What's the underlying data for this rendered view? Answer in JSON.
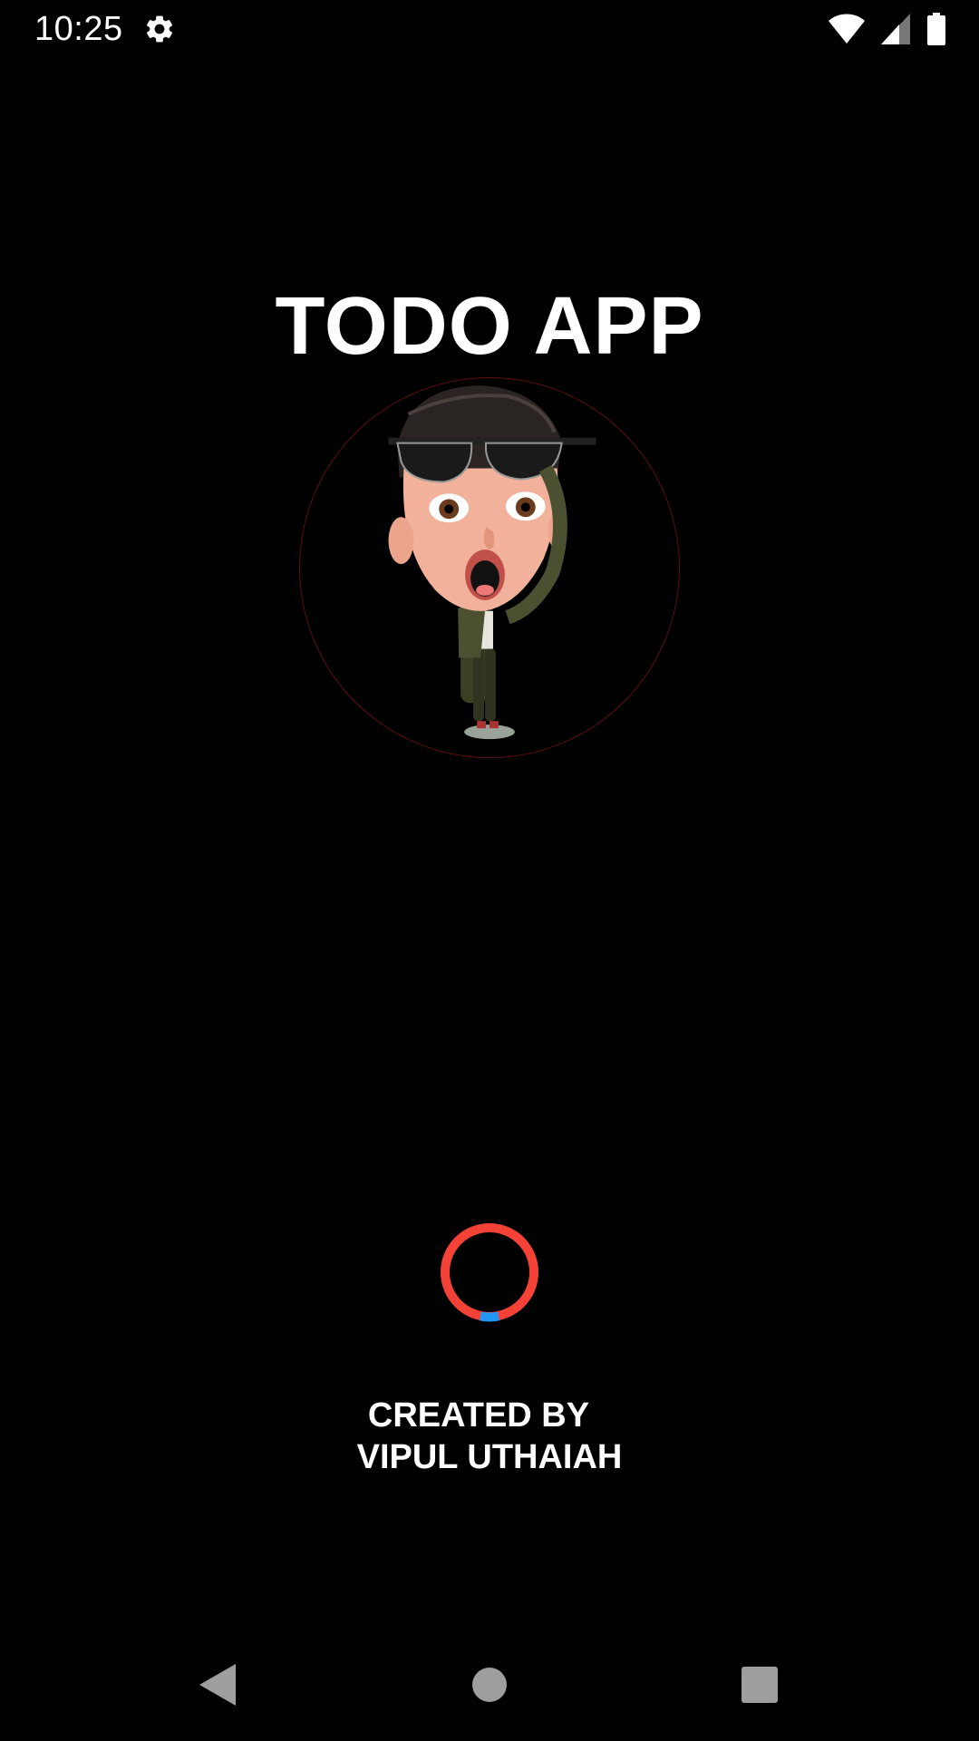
{
  "status_bar": {
    "time": "10:25",
    "icons": [
      "gear-icon",
      "wifi-icon",
      "cell-signal-icon",
      "battery-icon"
    ]
  },
  "app": {
    "title": "TODO APP",
    "avatar_alt": "cartoon-avatar-image"
  },
  "loader": {
    "ring_color": "#f44336",
    "accent_color": "#2196f3"
  },
  "credits": {
    "line1": "CREATED BY",
    "line2": "VIPUL UTHAIAH"
  },
  "nav_bar": {
    "buttons": [
      "back-icon",
      "home-icon",
      "recents-icon"
    ]
  },
  "colors": {
    "background": "#000000",
    "text": "#ffffff",
    "nav_icon": "#9e9e9e"
  }
}
